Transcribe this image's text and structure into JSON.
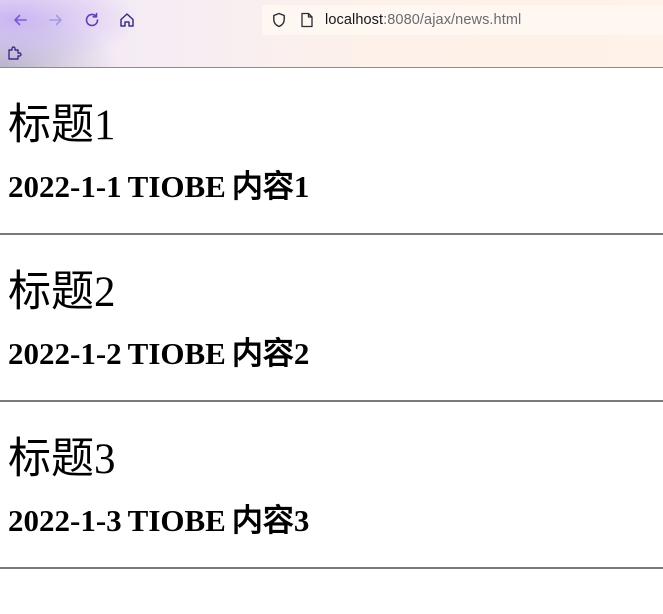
{
  "browser": {
    "url_host": "localhost",
    "url_rest": ":8080/ajax/news.html",
    "icons": {
      "back": "arrow-left-icon",
      "forward": "arrow-right-icon",
      "reload": "reload-icon",
      "home": "home-icon",
      "extensions": "puzzle-icon",
      "security": "shield-icon",
      "page": "page-icon"
    }
  },
  "news": [
    {
      "title": "标题1",
      "date": "2022-1-1",
      "source": "TIOBE",
      "content": "内容1"
    },
    {
      "title": "标题2",
      "date": "2022-1-2",
      "source": "TIOBE",
      "content": "内容2"
    },
    {
      "title": "标题3",
      "date": "2022-1-3",
      "source": "TIOBE",
      "content": "内容3"
    }
  ]
}
